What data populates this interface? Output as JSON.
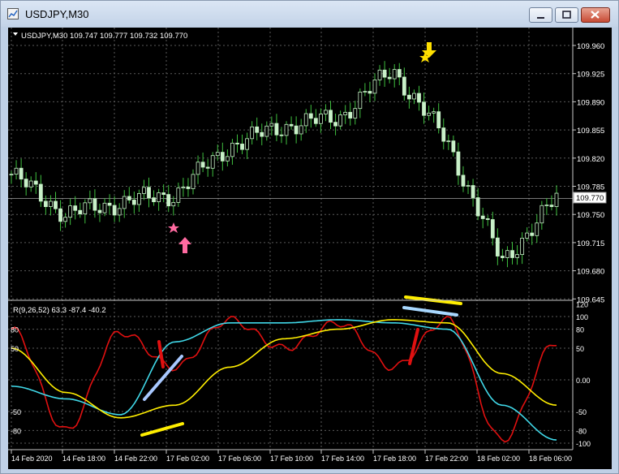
{
  "window": {
    "title": "USDJPY,M30",
    "buttons": [
      "minimize",
      "restore",
      "close"
    ]
  },
  "chart": {
    "header": "USDJPY,M30  109.747 109.777 109.732 109.770",
    "price_axis_labels": [
      "109.960",
      "109.925",
      "109.890",
      "109.855",
      "109.820",
      "109.785",
      "109.750",
      "109.715",
      "109.680",
      "109.645"
    ],
    "current_price": "109.770",
    "indicator_label": "R(9,26,52) 63.3 -87.4 -40.2",
    "indicator_axis_labels": [
      "120",
      "100",
      "80",
      "50",
      "0.00",
      "-50",
      "-80",
      "-100"
    ],
    "indicator_axis_left_labels": [
      "80",
      "50",
      "-50",
      "-80"
    ],
    "time_labels": [
      "14 Feb 2020",
      "14 Feb 18:00",
      "14 Feb 22:00",
      "17 Feb 02:00",
      "17 Feb 06:00",
      "17 Feb 10:00",
      "17 Feb 14:00",
      "17 Feb 18:00",
      "17 Feb 22:00",
      "18 Feb 02:00",
      "18 Feb 06:00"
    ],
    "colors": {
      "background": "#000000",
      "grid": "#5a5a5a",
      "candle": "#c8f0c8",
      "wick": "#3fbf3f",
      "line_red": "#e01010",
      "line_cyan": "#40d8e8",
      "line_yellow": "#ffee00",
      "marker_pink": "#ff6aa0",
      "marker_yellow": "#ffe000"
    }
  },
  "chart_data": {
    "type": "candlestick",
    "title": "USDJPY,M30",
    "ylim": [
      109.645,
      109.975
    ],
    "x": [
      "14 Feb 2020",
      "14 Feb 18:00",
      "14 Feb 22:00",
      "17 Feb 02:00",
      "17 Feb 06:00",
      "17 Feb 10:00",
      "17 Feb 14:00",
      "17 Feb 18:00",
      "17 Feb 22:00",
      "18 Feb 02:00",
      "18 Feb 06:00"
    ],
    "close": [
      109.8,
      109.75,
      109.765,
      109.775,
      109.835,
      109.86,
      109.87,
      109.93,
      109.84,
      109.69,
      109.77
    ],
    "last": {
      "open": 109.747,
      "high": 109.777,
      "low": 109.732,
      "close": 109.77
    },
    "indicator": {
      "name": "R(9,26,52)",
      "values": [
        63.3,
        -87.4,
        -40.2
      ],
      "ylim": [
        -100,
        120
      ],
      "series": [
        {
          "color": "#e01010",
          "values": [
            80,
            -80,
            75,
            20,
            95,
            50,
            90,
            20,
            95,
            -95,
            60
          ]
        },
        {
          "color": "#40d8e8",
          "values": [
            -10,
            -30,
            -55,
            60,
            90,
            90,
            95,
            90,
            80,
            -40,
            -95
          ]
        },
        {
          "color": "#ffee00",
          "values": [
            50,
            -20,
            -60,
            -40,
            20,
            65,
            80,
            95,
            90,
            10,
            -40
          ]
        }
      ]
    }
  }
}
